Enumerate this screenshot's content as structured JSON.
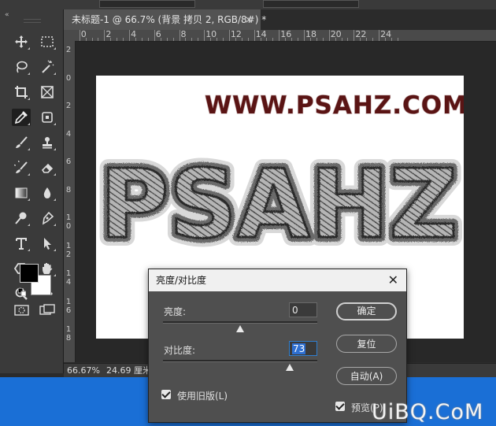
{
  "document": {
    "tab_title": "未标题-1 @ 66.7% (背景 拷贝 2, RGB/8#) *",
    "tab_close": "×",
    "canvas_url_text": "WWW.PSAHZ.COM",
    "canvas_main_text": "PSAHZ"
  },
  "rulers": {
    "horizontal": [
      "2",
      "0",
      "2",
      "4",
      "6",
      "8",
      "10",
      "12",
      "14",
      "16",
      "18",
      "20",
      "22",
      "24"
    ],
    "vertical": [
      "2",
      "0",
      "2",
      "4",
      "6",
      "8",
      "1 0",
      "1 2",
      "1 4",
      "1 6",
      "1 8"
    ]
  },
  "statusbar": {
    "zoom": "66.67%",
    "doc_size": "24.69 厘米"
  },
  "toolbar": {
    "collapse_glyph": "«",
    "colors": {
      "foreground": "#000000",
      "background": "#ffffff"
    }
  },
  "dialog": {
    "title": "亮度/对比度",
    "close": "✕",
    "brightness_label": "亮度:",
    "brightness_value": "0",
    "brightness": 0,
    "contrast_label": "对比度:",
    "contrast_value": "73",
    "contrast": 73,
    "ok_label": "确定",
    "reset_label": "复位",
    "auto_label": "自动(A)",
    "legacy_label": "使用旧版(L)",
    "preview_label": "预览(P)"
  },
  "watermark": "UiBQ.CoM"
}
